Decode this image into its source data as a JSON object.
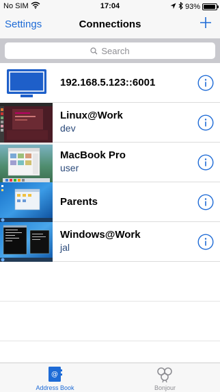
{
  "status_bar": {
    "carrier": "No SIM",
    "time": "17:04",
    "battery": "93%",
    "battery_level": 0.93
  },
  "nav": {
    "left_label": "Settings",
    "title": "Connections"
  },
  "search": {
    "placeholder": "Search"
  },
  "connections": [
    {
      "name": "192.168.5.123::6001",
      "user": ""
    },
    {
      "name": "Linux@Work",
      "user": "dev"
    },
    {
      "name": "MacBook Pro",
      "user": "user"
    },
    {
      "name": "Parents",
      "user": ""
    },
    {
      "name": "Windows@Work",
      "user": "jal"
    }
  ],
  "tabs": [
    {
      "label": "Address Book",
      "icon": "address-book-icon",
      "active": true
    },
    {
      "label": "Bonjour",
      "icon": "bonjour-icon",
      "active": false
    }
  ],
  "colors": {
    "accent": "#1e6bd6",
    "username": "#2b4a7a",
    "search_bg": "#c9c9ce"
  }
}
